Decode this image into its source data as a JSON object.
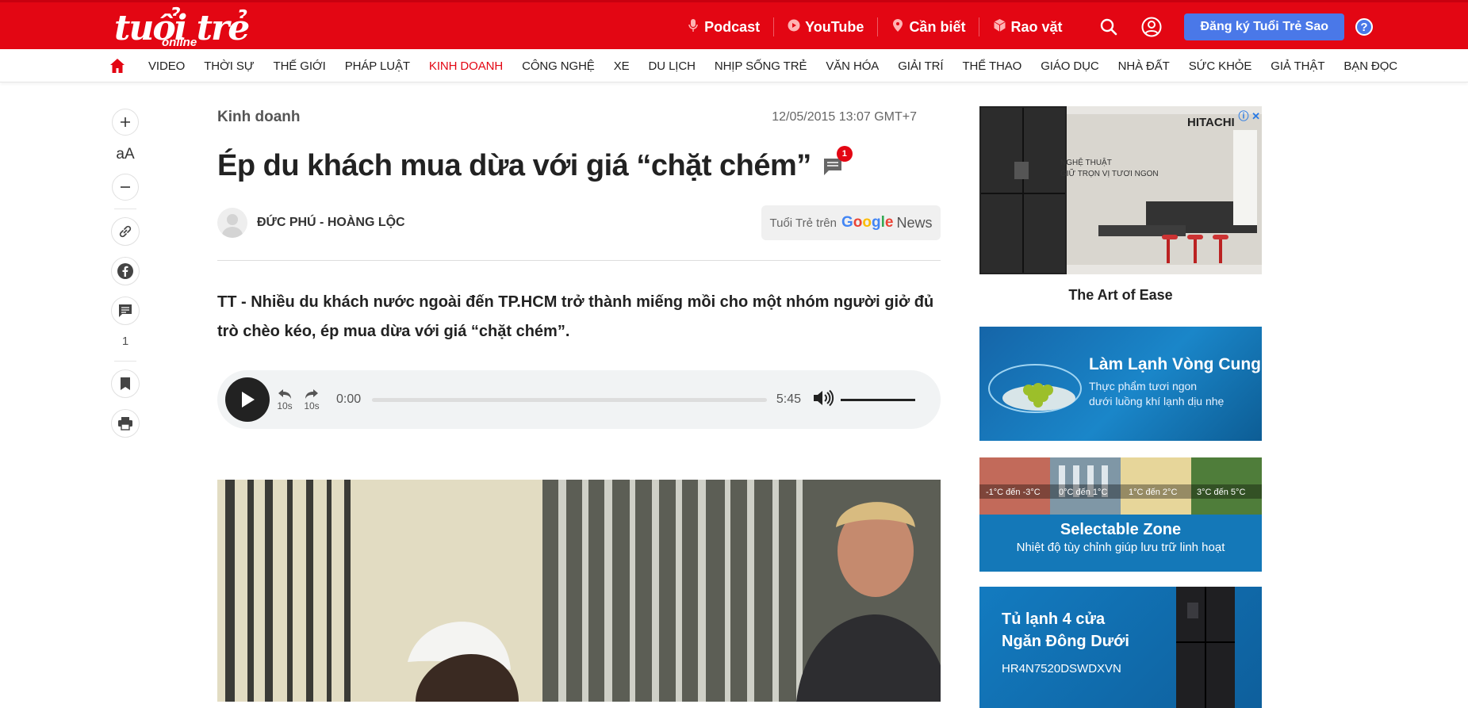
{
  "header": {
    "logo_text": "tuổi trẻ",
    "logo_sub": "online",
    "links": [
      {
        "label": "Podcast",
        "icon": "microphone-icon"
      },
      {
        "label": "YouTube",
        "icon": "youtube-icon"
      },
      {
        "label": "Cần biết",
        "icon": "pin-icon"
      },
      {
        "label": "Rao vặt",
        "icon": "cube-icon"
      }
    ],
    "signup_label": "Đăng ký Tuổi Trẻ Sao",
    "help_label": "?"
  },
  "nav": {
    "items": [
      "VIDEO",
      "THỜI SỰ",
      "THẾ GIỚI",
      "PHÁP LUẬT",
      "KINH DOANH",
      "CÔNG NGHỆ",
      "XE",
      "DU LỊCH",
      "NHỊP SỐNG TRẺ",
      "VĂN HÓA",
      "GIẢI TRÍ",
      "THỂ THAO",
      "GIÁO DỤC",
      "NHÀ ĐẤT",
      "SỨC KHỎE",
      "GIẢ THẬT",
      "BẠN ĐỌC"
    ],
    "active": "KINH DOANH"
  },
  "rail": {
    "font_label": "aA",
    "comment_count": "1"
  },
  "article": {
    "category": "Kinh doanh",
    "date": "12/05/2015 13:07 GMT+7",
    "title": "Ép du khách mua dừa với giá “chặt chém”",
    "comment_badge": "1",
    "author": "ĐỨC PHÚ - HOÀNG LỘC",
    "gnews_prefix": "Tuổi Trẻ trên",
    "gnews_google": "Google",
    "gnews_news": "News",
    "sapo": "TT - Nhiều du khách nước ngoài đến TP.HCM trở thành miếng mồi cho một nhóm người giở đủ trò chèo kéo, ép mua dừa với giá “chặt chém”."
  },
  "player": {
    "current_time": "0:00",
    "duration": "5:45",
    "rewind_label": "10s",
    "forward_label": "10s",
    "progress": 0
  },
  "ads": {
    "ad1_brand": "HITACHI",
    "ad1_text1": "NGHỆ THUẬT",
    "ad1_text2": "GIỮ TRỌN VỊ TƯƠI NGON",
    "ad1_caption": "The Art of Ease",
    "ad2_title": "Làm Lạnh Vòng Cung",
    "ad2_sub1": "Thực phẩm tươi ngon",
    "ad2_sub2": "dưới luồng khí lạnh dịu nhẹ",
    "ad3_zones": [
      "-1°C đến -3°C",
      "0°C đến 1°C",
      "1°C đến 2°C",
      "3°C đến 5°C"
    ],
    "ad3_title": "Selectable Zone",
    "ad3_sub": "Nhiệt độ tùy chỉnh giúp lưu trữ linh hoạt",
    "ad4_title1": "Tủ lạnh 4 cửa",
    "ad4_title2": "Ngăn Đông Dưới",
    "ad4_model": "HR4N7520DSWDXVN"
  },
  "colors": {
    "brand": "#e30613",
    "accent": "#4a78e8"
  }
}
